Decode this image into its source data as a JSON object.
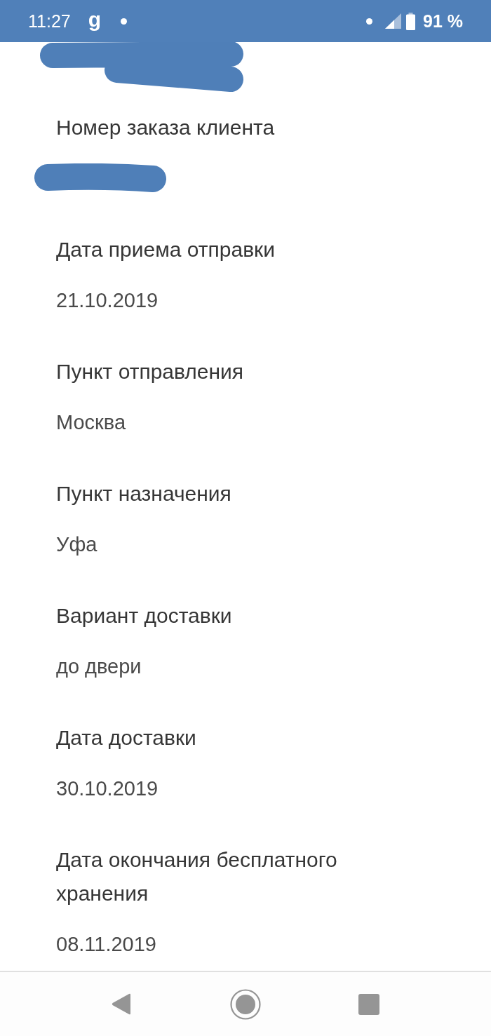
{
  "status_bar": {
    "time": "11:27",
    "notification_glyph": "g",
    "battery_text": "91 %"
  },
  "fields": [
    {
      "kind": "redacted"
    },
    {
      "label": "Номер заказа клиента",
      "kind": "redacted"
    },
    {
      "label": "Дата приема отправки",
      "kind": "text",
      "value": "21.10.2019"
    },
    {
      "label": "Пункт отправления",
      "kind": "text",
      "value": "Москва"
    },
    {
      "label": "Пункт назначения",
      "kind": "text",
      "value": "Уфа"
    },
    {
      "label": "Вариант доставки",
      "kind": "text",
      "value": "до двери"
    },
    {
      "label": "Дата доставки",
      "kind": "text",
      "value": "30.10.2019"
    },
    {
      "label": "Дата окончания бесплатного хранения",
      "kind": "text",
      "value": "08.11.2019"
    }
  ]
}
